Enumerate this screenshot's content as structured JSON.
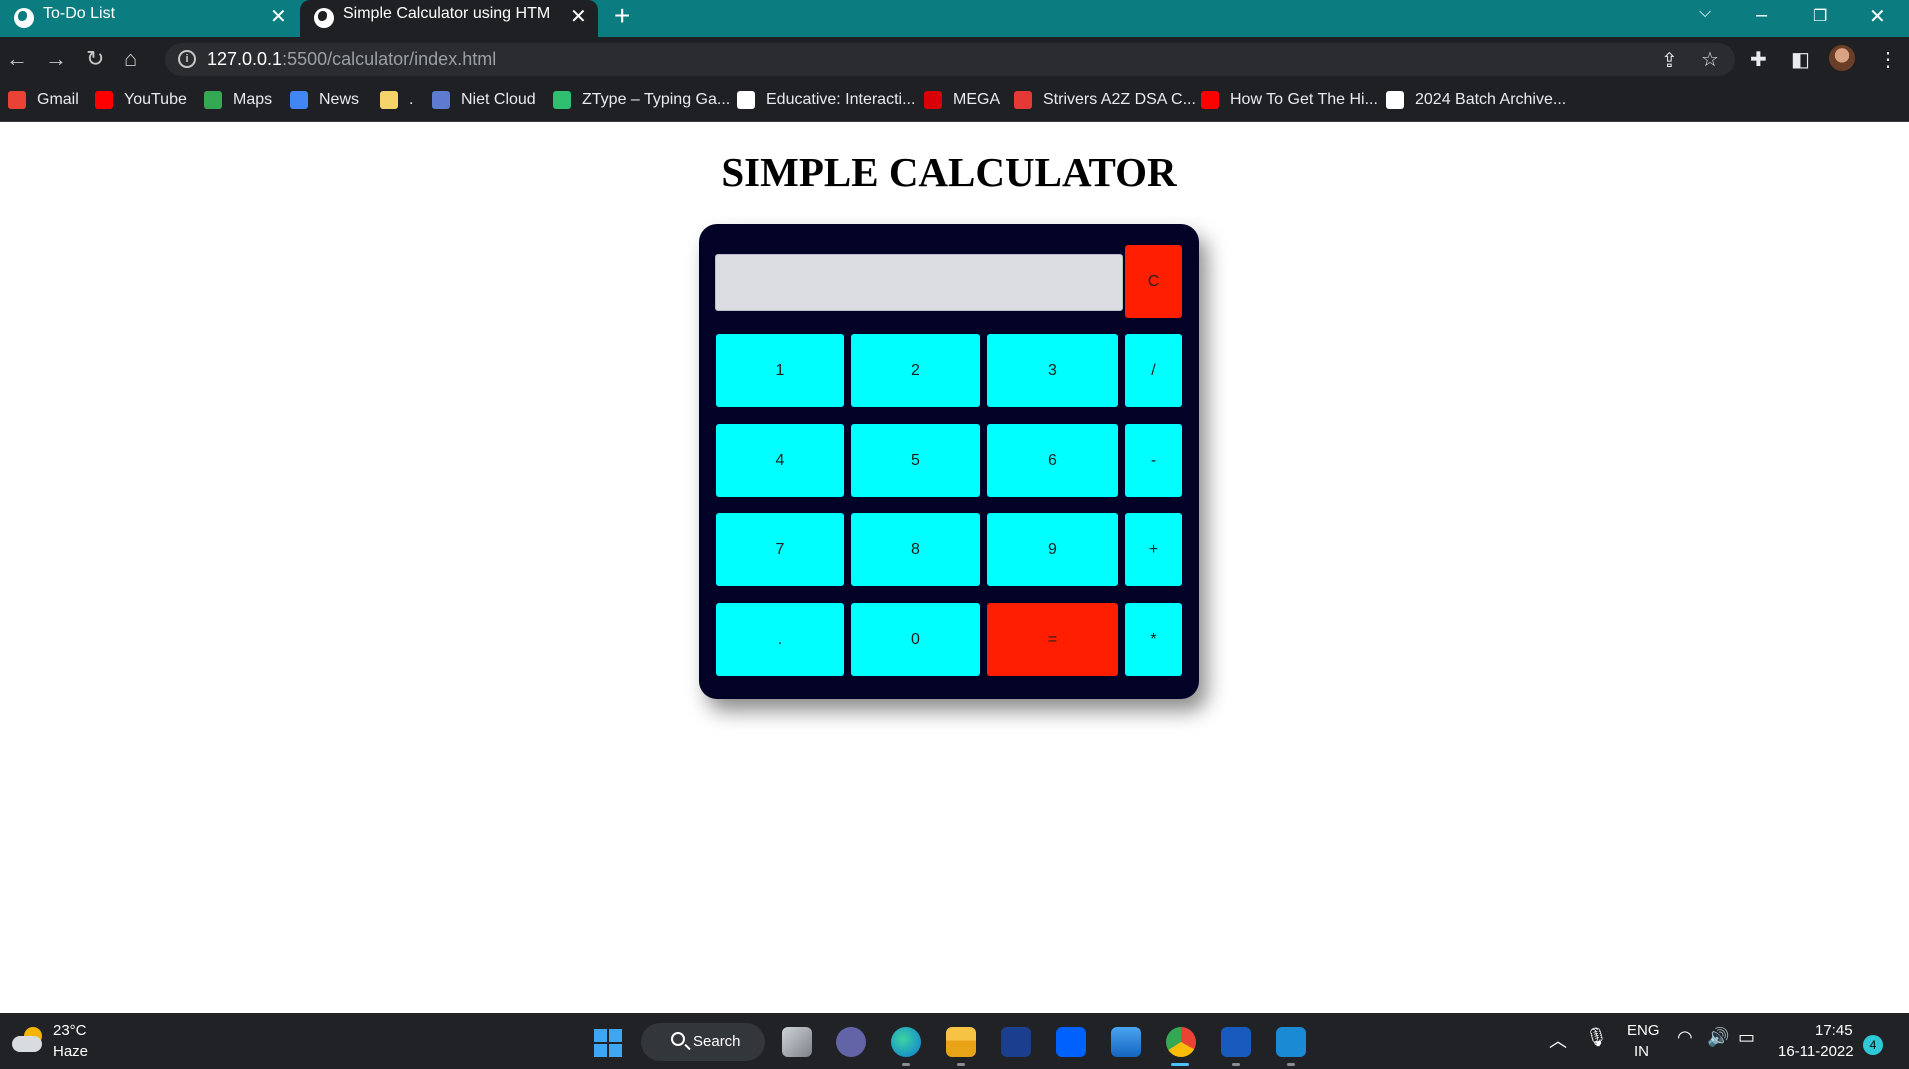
{
  "browser": {
    "tabs": [
      {
        "title": "To-Do List"
      },
      {
        "title": "Simple Calculator using HTML, C"
      }
    ],
    "url_host": "127.0.0.1",
    "url_rest": ":5500/calculator/index.html",
    "bookmarks": [
      {
        "label": "Gmail",
        "icon": "gmail-icon",
        "color": "#ea4335"
      },
      {
        "label": "YouTube",
        "icon": "youtube-icon",
        "color": "#ff0000"
      },
      {
        "label": "Maps",
        "icon": "maps-icon",
        "color": "#34a853"
      },
      {
        "label": "News",
        "icon": "news-icon",
        "color": "#4285f4"
      },
      {
        "label": ".",
        "icon": "folder-icon",
        "color": "#f6d36b"
      },
      {
        "label": "Niet Cloud",
        "icon": "cloud-icon",
        "color": "#5f7bd0"
      },
      {
        "label": "ZType – Typing Ga...",
        "icon": "ztype-icon",
        "color": "#2fbf71"
      },
      {
        "label": "Educative: Interacti...",
        "icon": "educative-icon",
        "color": "#ffffff"
      },
      {
        "label": "MEGA",
        "icon": "mega-icon",
        "color": "#d90007"
      },
      {
        "label": "Strivers A2Z DSA C...",
        "icon": "tuf-icon",
        "color": "#e53935"
      },
      {
        "label": "How To Get The Hi...",
        "icon": "youtube-icon",
        "color": "#ff0000"
      },
      {
        "label": "2024 Batch Archive...",
        "icon": "archive-icon",
        "color": "#ffffff"
      }
    ]
  },
  "page": {
    "title": "SIMPLE CALCULATOR"
  },
  "calculator": {
    "display_value": "",
    "clear_label": "C",
    "keys": [
      "1",
      "2",
      "3",
      "/",
      "4",
      "5",
      "6",
      "-",
      "7",
      "8",
      "9",
      "+",
      ".",
      "0",
      "=",
      "*"
    ],
    "colors": {
      "body": "#020126",
      "key": "#00ffff",
      "accent": "#ff1e00",
      "display": "#dcdde2"
    }
  },
  "taskbar": {
    "temperature": "23°C",
    "weather": "Haze",
    "search_label": "Search",
    "lang_top": "ENG",
    "lang_bottom": "IN",
    "time": "17:45",
    "date": "16-11-2022",
    "notification_count": "4"
  }
}
